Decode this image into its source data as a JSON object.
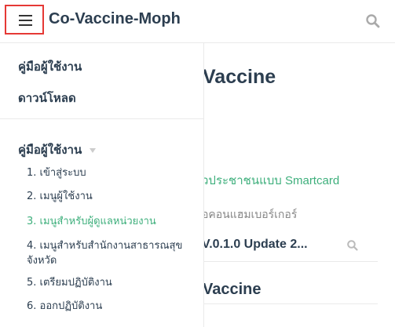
{
  "header": {
    "title": "Co-Vaccine-Moph",
    "menu_icon": "hamburger-menu-icon",
    "search_icon": "search-icon"
  },
  "main": {
    "heading": "Vaccine",
    "link_text": "วประชาชนแบบ Smartcard",
    "subtext": "อคอนแฮมเบอร์เกอร์",
    "version_text": "V.0.1.0 Update 2...",
    "heading2": "Vaccine"
  },
  "sidebar": {
    "nav_links": [
      {
        "label": "คู่มือผู้ใช้งาน"
      },
      {
        "label": "ดาวน์โหลด"
      }
    ],
    "group_title": "คู่มือผู้ใช้งาน",
    "items": [
      {
        "label": "1. เข้าสู่ระบบ"
      },
      {
        "label": "2. เมนูผู้ใช้งาน"
      },
      {
        "label": "3. เมนูสำหรับผู้ดูแลหน่วยงาน",
        "active": true
      },
      {
        "label": "4. เมนูสำหรับสำนักงานสาธารณสุขจังหวัด"
      },
      {
        "label": "5. เตรียมปฏิบัติงาน"
      },
      {
        "label": "6. ออกปฏิบัติงาน"
      }
    ]
  },
  "colors": {
    "accent": "#3eaf7c",
    "highlight_border": "#e53935",
    "text": "#2c3e50"
  }
}
